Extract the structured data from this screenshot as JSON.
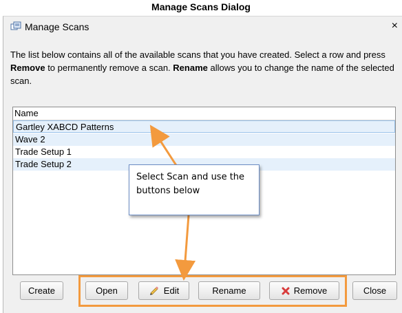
{
  "caption": "Manage Scans Dialog",
  "window": {
    "title": "Manage Scans",
    "close_glyph": "×"
  },
  "description": {
    "part1": "The list below contains all of the available scans that you have created. Select a row and press ",
    "remove_word": "Remove",
    "part2": " to permanently remove a scan. ",
    "rename_word": "Rename",
    "part3": " allows you to change the name of the selected scan."
  },
  "list": {
    "header": "Name",
    "rows": [
      "Gartley XABCD Patterns",
      "Wave 2",
      "Trade Setup 1",
      "Trade Setup 2"
    ],
    "selected_index": 0
  },
  "callout": {
    "text": "Select Scan and use the buttons below"
  },
  "buttons": {
    "create": "Create",
    "open": "Open",
    "edit": "Edit",
    "rename": "Rename",
    "remove": "Remove",
    "close": "Close"
  },
  "colors": {
    "highlight": "#f39a3e",
    "row_alt": "#e5f0fb",
    "callout_border": "#6b8cc4"
  },
  "icons": {
    "title": "scans-window-icon",
    "edit": "pencil-icon",
    "remove": "red-x-icon"
  }
}
